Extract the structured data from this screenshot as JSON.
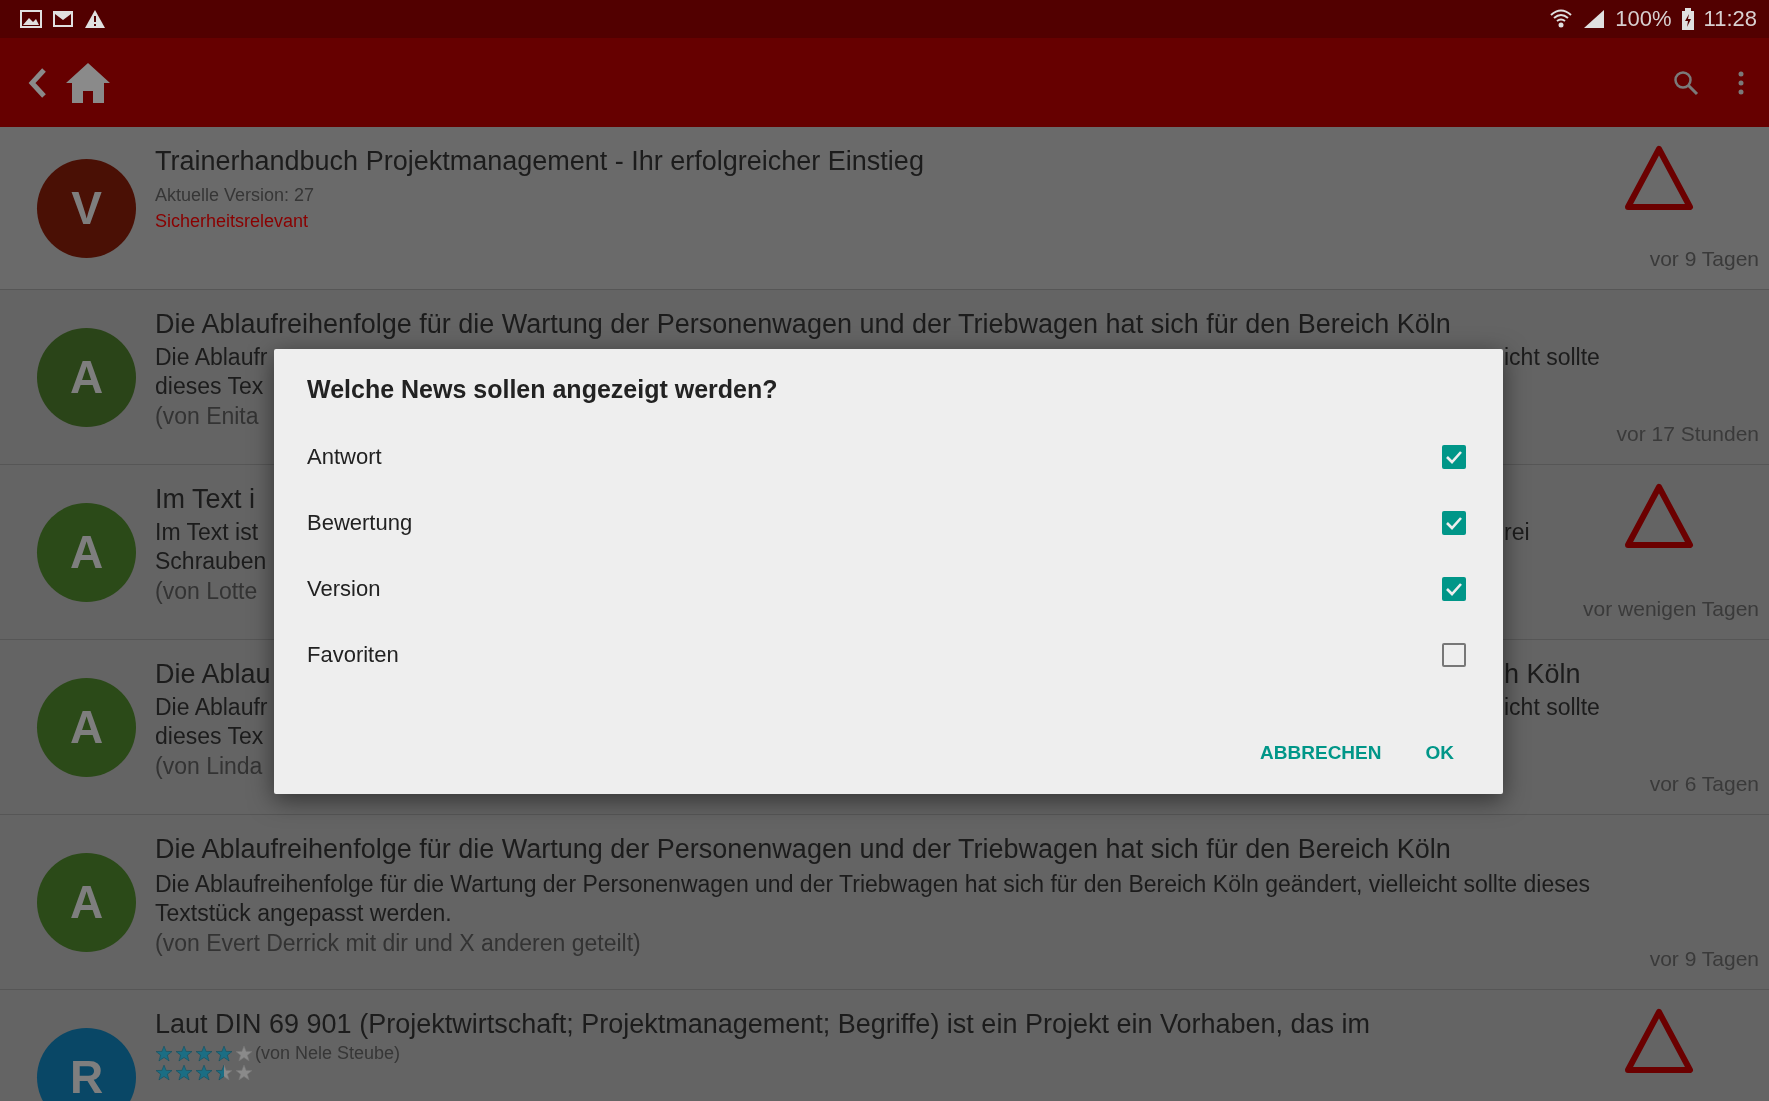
{
  "status_bar": {
    "battery": "100%",
    "time": "11:28"
  },
  "news": [
    {
      "kind": "version",
      "avatar": "V",
      "color": "#4a1005",
      "title": "Trainerhandbuch Projektmanagement - Ihr erfolgreicher Einstieg",
      "subtitle": "Aktuelle Version: 27",
      "flag": "Sicherheitsrelevant",
      "warning": true,
      "time": "vor 9 Tagen"
    },
    {
      "kind": "text",
      "avatar": "A",
      "color": "#2a4418",
      "title": "Die Ablaufreihenfolge für die Wartung der Personenwagen und der Triebwagen hat sich für den Bereich Köln",
      "body": [
        {
          "text": "Die Ablaufr",
          "tail": "icht sollte"
        },
        {
          "text": "dieses Tex"
        }
      ],
      "author": {
        "text": "(von Enita"
      },
      "warning": false,
      "time": "vor 17 Stunden"
    },
    {
      "kind": "text",
      "avatar": "A",
      "color": "#2b4a18",
      "title": {
        "text": "Im Text i"
      },
      "body": [
        {
          "text": "Im Text ist",
          "tail": "rei"
        },
        {
          "text": "Schrauben"
        }
      ],
      "author": {
        "text": "(von Lotte"
      },
      "warning": true,
      "time": "vor wenigen Tagen"
    },
    {
      "kind": "text",
      "avatar": "A",
      "color": "#2b4a18",
      "title": {
        "text": "Die Ablau",
        "tail": "h Köln"
      },
      "body": [
        {
          "text": "Die Ablaufr",
          "tail": "icht sollte"
        },
        {
          "text": "dieses Tex"
        }
      ],
      "author": {
        "text": "(von Linda"
      },
      "warning": false,
      "time": "vor 6 Tagen"
    },
    {
      "kind": "text",
      "avatar": "A",
      "color": "#2b4a18",
      "title": "Die Ablaufreihenfolge für die Wartung der Personenwagen und der Triebwagen hat sich für den Bereich Köln",
      "body": "Die Ablaufreihenfolge für die Wartung der Personenwagen und der Triebwagen hat sich für den Bereich Köln geändert, vielleicht sollte dieses Textstück angepasst werden.",
      "author": "(von Evert Derrick mit dir und X anderen geteilt)",
      "warning": false,
      "time": "vor 9 Tagen"
    },
    {
      "kind": "rating",
      "avatar": "R",
      "color": "#094766",
      "title": "Laut DIN 69 901 (Projektwirtschaft; Projektmanagement; Begriffe) ist ein Projekt ein Vorhaben, das im",
      "ratings": [
        {
          "stars": 4,
          "author": "(von Nele Steube)"
        },
        {
          "stars": 3.5
        }
      ],
      "warning": true
    }
  ],
  "dialog": {
    "title": "Welche News sollen angezeigt werden?",
    "options": [
      {
        "label": "Antwort",
        "checked": true
      },
      {
        "label": "Bewertung",
        "checked": true
      },
      {
        "label": "Version",
        "checked": true
      },
      {
        "label": "Favoriten",
        "checked": false
      }
    ],
    "buttons": [
      "ABBRECHEN",
      "OK"
    ]
  }
}
